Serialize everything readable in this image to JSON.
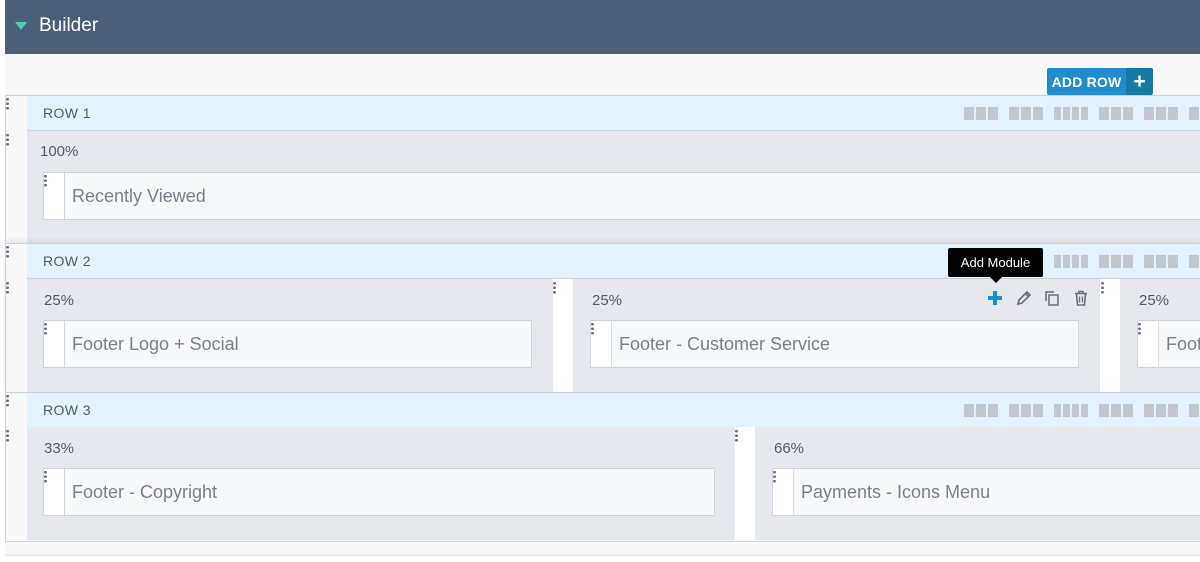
{
  "header": {
    "title": "Builder"
  },
  "toolbar": {
    "add_row_label": "ADD ROW",
    "add_row_icon": "plus-icon"
  },
  "tooltip": {
    "text": "Add Module"
  },
  "colors": {
    "header_bg": "#4d5e78",
    "accent": "#1f8dcf",
    "row_header_bg": "#e3f2fc",
    "caret": "#4fd1a8"
  },
  "rows": [
    {
      "title": "ROW 1",
      "columns": [
        {
          "width": "100%",
          "module": "Recently Viewed"
        }
      ]
    },
    {
      "title": "ROW 2",
      "columns": [
        {
          "width": "25%",
          "module": "Footer Logo + Social"
        },
        {
          "width": "25%",
          "module": "Footer - Customer Service"
        },
        {
          "width": "25%",
          "module": "Foot"
        }
      ]
    },
    {
      "title": "ROW 3",
      "columns": [
        {
          "width": "33%",
          "module": "Footer - Copyright"
        },
        {
          "width": "66%",
          "module": "Payments - Icons Menu"
        }
      ]
    }
  ]
}
